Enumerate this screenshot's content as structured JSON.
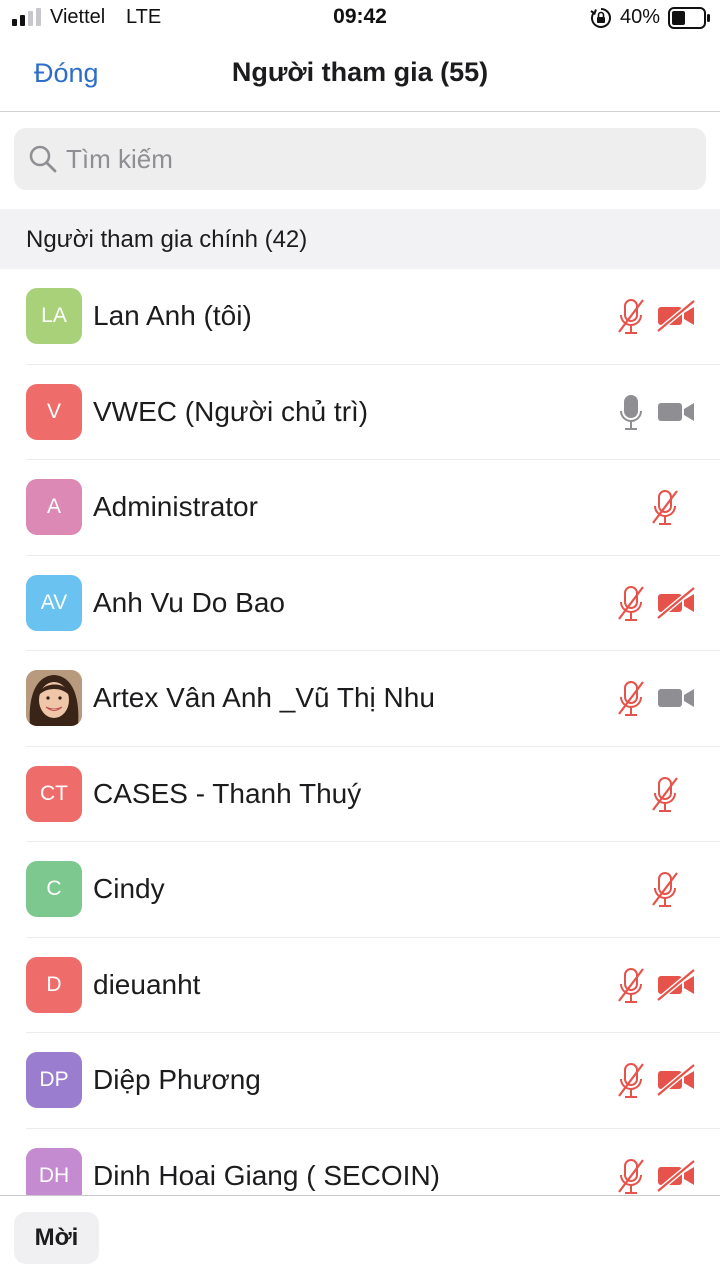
{
  "status_bar": {
    "carrier": "Viettel",
    "network": "LTE",
    "time": "09:42",
    "battery_percent": "40%"
  },
  "nav": {
    "close_label": "Đóng",
    "title": "Người tham gia (55)"
  },
  "search": {
    "placeholder": "Tìm kiếm"
  },
  "section": {
    "title": "Người tham gia chính (42)"
  },
  "participants": [
    {
      "initials": "LA",
      "name": "Lan Anh (tôi)",
      "avatar_color": "#a9d17a",
      "mic": "muted",
      "video": "off"
    },
    {
      "initials": "V",
      "name": "VWEC (Người chủ trì)",
      "avatar_color": "#ee6d6a",
      "mic": "on",
      "video": "on"
    },
    {
      "initials": "A",
      "name": "Administrator",
      "avatar_color": "#dc89b5",
      "mic": "muted",
      "video": "none"
    },
    {
      "initials": "AV",
      "name": "Anh Vu Do Bao",
      "avatar_color": "#69c2f0",
      "mic": "muted",
      "video": "off"
    },
    {
      "initials": "",
      "name": "Artex Vân Anh _Vũ Thị Nhu",
      "avatar_color": "#c9a48b",
      "avatar_type": "photo",
      "mic": "muted",
      "video": "on"
    },
    {
      "initials": "CT",
      "name": "CASES - Thanh Thuý",
      "avatar_color": "#ee6d6a",
      "mic": "muted",
      "video": "none"
    },
    {
      "initials": "C",
      "name": "Cindy",
      "avatar_color": "#7cc88e",
      "mic": "muted",
      "video": "none"
    },
    {
      "initials": "D",
      "name": "dieuanht",
      "avatar_color": "#ee6d6a",
      "mic": "muted",
      "video": "off"
    },
    {
      "initials": "DP",
      "name": "Diệp Phương",
      "avatar_color": "#9b7dd0",
      "mic": "muted",
      "video": "off"
    },
    {
      "initials": "DH",
      "name": "Dinh Hoai Giang ( SECOIN)",
      "avatar_color": "#c48bd0",
      "mic": "muted",
      "video": "off"
    }
  ],
  "colors": {
    "accent": "#2d6ec9",
    "muted_red": "#e5534b",
    "icon_gray": "#8e8e93"
  },
  "icons": {
    "mic_on": "microphone-icon",
    "mic_muted": "microphone-muted-icon",
    "video_on": "video-camera-icon",
    "video_off": "video-camera-off-icon"
  },
  "footer": {
    "invite_label": "Mời"
  }
}
